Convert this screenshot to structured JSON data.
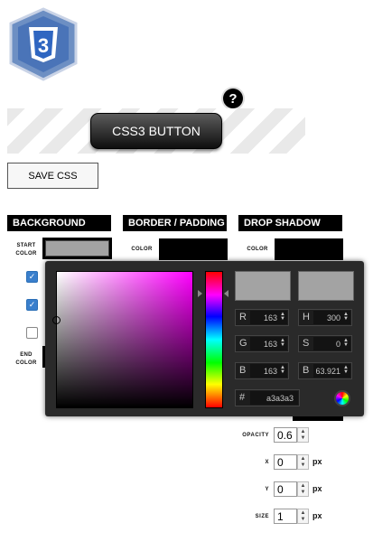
{
  "logo": {
    "alt_text": "3"
  },
  "help": {
    "label": "?"
  },
  "preview": {
    "button_label": "CSS3 BUTTON"
  },
  "actions": {
    "save_label": "SAVE CSS"
  },
  "sections": {
    "background": "BACKGROUND",
    "border_padding": "BORDER / PADDING",
    "drop_shadow": "DROP SHADOW"
  },
  "background": {
    "start_color_label": "START COLOR",
    "end_color_label": "END COLOR",
    "start_color_value": "#a3a3a3",
    "checkboxes": [
      true,
      true,
      false
    ]
  },
  "border": {
    "color_label": "COLOR"
  },
  "shadow": {
    "color_label": "COLOR",
    "opacity_label": "OPACITY",
    "opacity_value": "0.6",
    "x_label": "X",
    "x_value": "0",
    "x_unit": "px",
    "y_label": "Y",
    "y_value": "0",
    "y_unit": "px",
    "size_label": "SIZE",
    "size_value": "1",
    "size_unit": "px"
  },
  "picker": {
    "current_color": "#a3a3a3",
    "r_label": "R",
    "r": "163",
    "g_label": "G",
    "g": "163",
    "b_label": "B",
    "b": "163",
    "h_label": "H",
    "h": "300",
    "s_label": "S",
    "s": "0",
    "v_label": "B",
    "v": "63.921",
    "hex_label": "#",
    "hex": "a3a3a3"
  }
}
